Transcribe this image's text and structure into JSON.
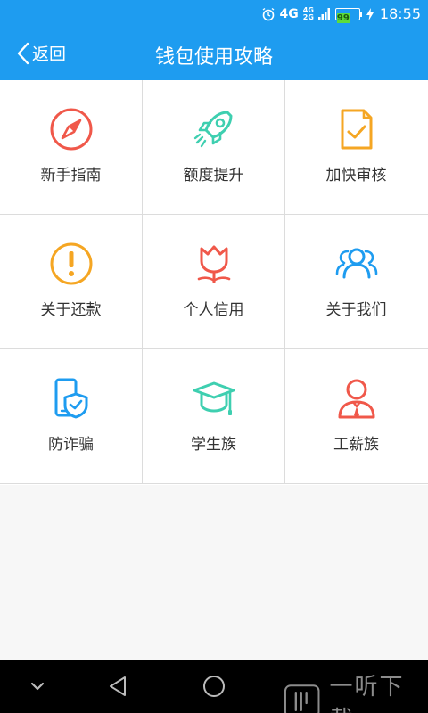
{
  "status_bar": {
    "network": "4G",
    "network_top": "4G",
    "network_bottom": "2G",
    "battery": "99",
    "time": "18:55"
  },
  "header": {
    "back_label": "返回",
    "title": "钱包使用攻略"
  },
  "grid": {
    "items": [
      {
        "label": "新手指南",
        "icon": "compass-icon",
        "color": "#f0584a"
      },
      {
        "label": "额度提升",
        "icon": "rocket-icon",
        "color": "#3ecfb0"
      },
      {
        "label": "加快审核",
        "icon": "document-check-icon",
        "color": "#f5a623"
      },
      {
        "label": "关于还款",
        "icon": "exclamation-circle-icon",
        "color": "#f5a623"
      },
      {
        "label": "个人信用",
        "icon": "tulip-icon",
        "color": "#f0584a"
      },
      {
        "label": "关于我们",
        "icon": "users-icon",
        "color": "#1e9cf0"
      },
      {
        "label": "防诈骗",
        "icon": "phone-shield-icon",
        "color": "#1e9cf0"
      },
      {
        "label": "学生族",
        "icon": "graduation-cap-icon",
        "color": "#3ecfb0"
      },
      {
        "label": "工薪族",
        "icon": "worker-icon",
        "color": "#f0584a"
      }
    ]
  },
  "watermark": {
    "text": "一听下载"
  },
  "colors": {
    "primary": "#1e9cf0",
    "red": "#f0584a",
    "teal": "#3ecfb0",
    "orange": "#f5a623"
  }
}
